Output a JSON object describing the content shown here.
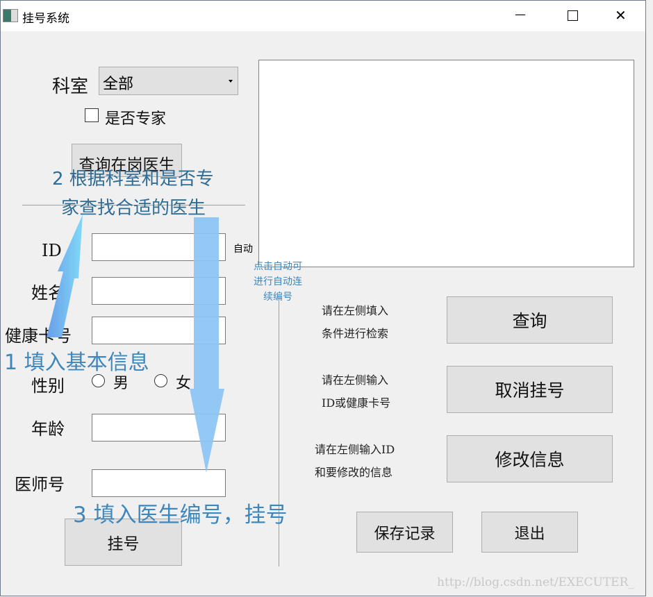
{
  "window": {
    "title": "挂号系统",
    "minimize": "—",
    "maximize": "☐",
    "close": "✕"
  },
  "left": {
    "dept_label": "科室",
    "dept_value": "全部",
    "expert_label": "是否专家",
    "expert_checked": false,
    "query_doctor_button": "查询在岗医生",
    "id_label": "ID",
    "auto_label": "自动",
    "name_label": "姓名",
    "card_label": "健康卡号",
    "gender_label": "性别",
    "male": "男",
    "female": "女",
    "age_label": "年龄",
    "doctor_no_label": "医师号",
    "register_button": "挂号"
  },
  "right": {
    "hint_query": [
      "请在左侧填入",
      "条件进行检索"
    ],
    "query_button": "查询",
    "hint_cancel": [
      "请在左侧输入",
      "ID或健康卡号"
    ],
    "cancel_button": "取消挂号",
    "hint_modify": [
      "请在左侧输入ID",
      "和要修改的信息"
    ],
    "modify_button": "修改信息",
    "save_button": "保存记录",
    "exit_button": "退出"
  },
  "annotations": {
    "step1": "1 填入基本信息",
    "step2_line1": "2 根据科室和是否专",
    "step2_line2": "家查找合适的医生",
    "step3": "3 填入医生编号，挂号",
    "auto_note": [
      "点击自动可",
      "进行自动连",
      "续编号"
    ],
    "arrow_color": "#8cc4f4"
  },
  "watermark": "http://blog.csdn.net/EXECUTER_"
}
